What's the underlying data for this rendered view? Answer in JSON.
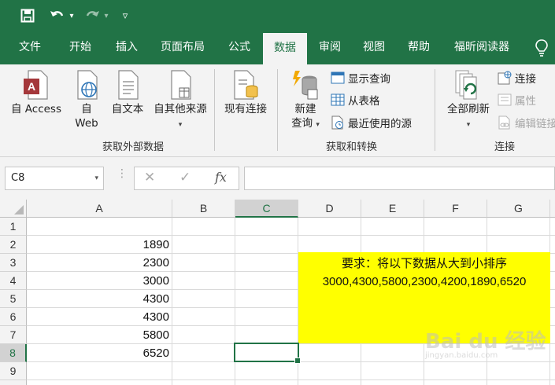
{
  "qat": {
    "icons": [
      "save-icon",
      "undo-icon",
      "redo-icon",
      "customize-qat-icon"
    ],
    "dropdown_glyph": "▾",
    "customize_glyph": "▿"
  },
  "tabs": [
    {
      "label": "文件",
      "active": false
    },
    {
      "label": "开始",
      "active": false
    },
    {
      "label": "插入",
      "active": false
    },
    {
      "label": "页面布局",
      "active": false
    },
    {
      "label": "公式",
      "active": false
    },
    {
      "label": "数据",
      "active": true
    },
    {
      "label": "审阅",
      "active": false
    },
    {
      "label": "视图",
      "active": false
    },
    {
      "label": "帮助",
      "active": false
    },
    {
      "label": "福昕阅读器",
      "active": false
    }
  ],
  "tell_me_icon": "lightbulb-icon",
  "ribbon": {
    "get_external": {
      "label": "获取外部数据",
      "access": "自 Access",
      "web_line1": "自",
      "web_line2": "Web",
      "text": "自文本",
      "other": "自其他来源"
    },
    "existing": {
      "label": "现有连接"
    },
    "get_transform": {
      "label": "获取和转换",
      "new_query_line1": "新建",
      "new_query_line2": "查询",
      "show_queries": "显示查询",
      "from_table": "从表格",
      "recent_sources": "最近使用的源"
    },
    "connections": {
      "label": "连接",
      "refresh_all": "全部刷新",
      "connections": "连接",
      "properties": "属性",
      "edit_links": "编辑链接"
    }
  },
  "formula_bar": {
    "name_box": "C8",
    "cancel": "✕",
    "enter": "✓",
    "fx": "fx",
    "formula": ""
  },
  "grid": {
    "columns": [
      "A",
      "B",
      "C",
      "D",
      "E",
      "F",
      "G"
    ],
    "selected_column": "C",
    "rows": [
      "1",
      "2",
      "3",
      "4",
      "5",
      "6",
      "7",
      "8",
      "9"
    ],
    "selected_row": "8",
    "column_a_values": [
      "",
      "1890",
      "2300",
      "3000",
      "4300",
      "4300",
      "5800",
      "6520",
      ""
    ],
    "note_line1": "要求：将以下数据从大到小排序",
    "note_line2": "3000,4300,5800,2300,4200,1890,6520",
    "note_color": "#ffff00",
    "active_cell": "C8"
  },
  "colors": {
    "excel_green": "#217346",
    "ribbon_bg": "#f3f3f3"
  },
  "watermark": {
    "line1": "Bai du 经验",
    "line2": "jingyan.baidu.com"
  }
}
